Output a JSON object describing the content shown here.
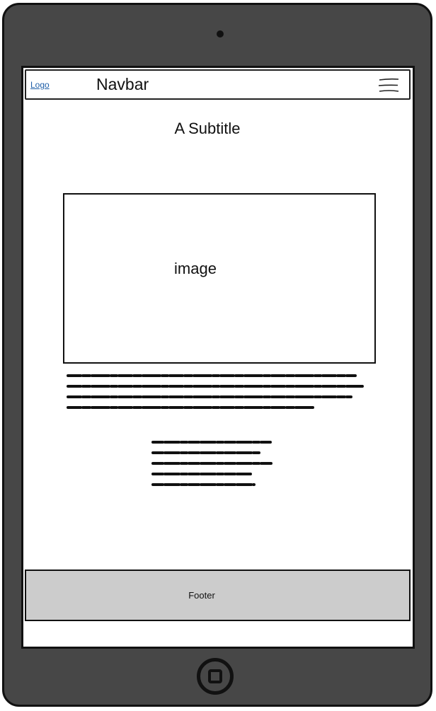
{
  "navbar": {
    "logo_label": "Logo",
    "title": "Navbar",
    "menu_icon": "hamburger-menu-icon"
  },
  "main": {
    "subtitle": "A Subtitle",
    "image_label": "image"
  },
  "footer": {
    "label": "Footer"
  },
  "device": {
    "frame_color": "#474747",
    "footer_color": "#cccccc",
    "link_color": "#1f5fa8",
    "home_icon": "home-button-icon",
    "camera_icon": "camera-icon"
  }
}
